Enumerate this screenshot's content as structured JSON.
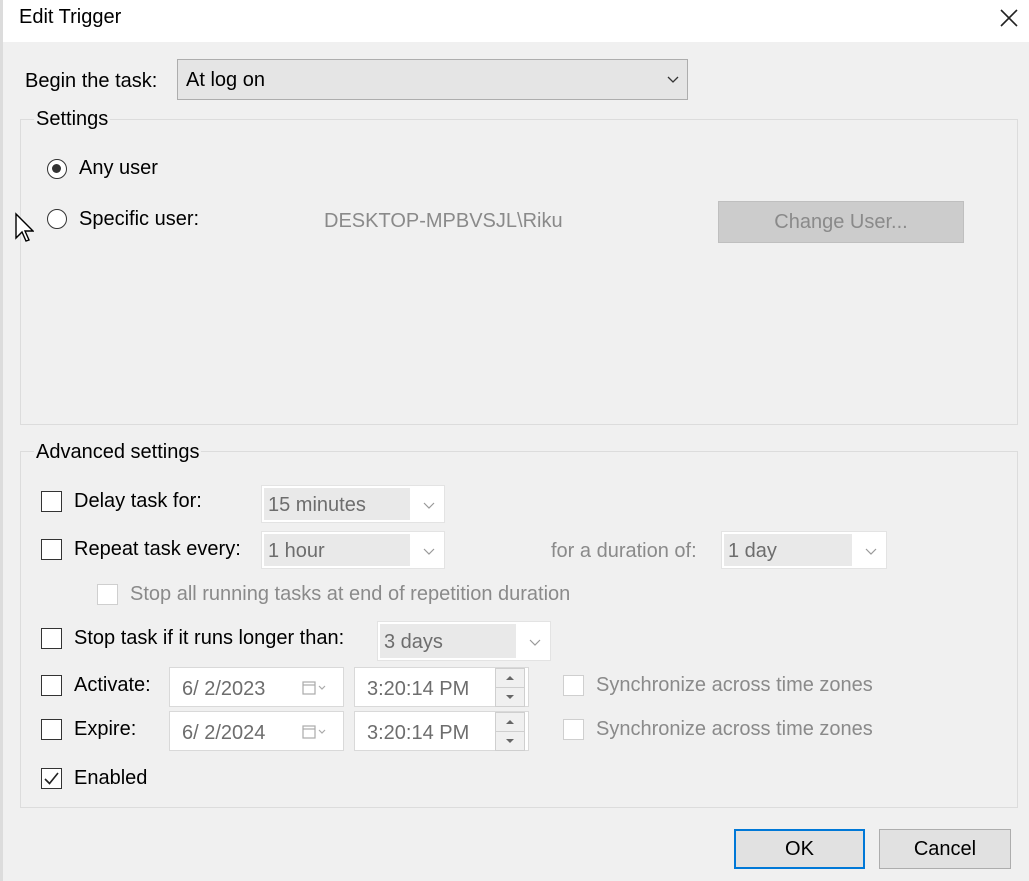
{
  "window": {
    "title": "Edit Trigger"
  },
  "begin": {
    "label": "Begin the task:",
    "value": "At log on"
  },
  "settings": {
    "title": "Settings",
    "any_user_label": "Any user",
    "specific_user_label": "Specific user:",
    "user_name": "DESKTOP-MPBVSJL\\Riku",
    "change_user_button": "Change User...",
    "selected": "any_user"
  },
  "advanced": {
    "title": "Advanced settings",
    "delay": {
      "label": "Delay task for:",
      "value": "15 minutes",
      "checked": false
    },
    "repeat": {
      "label": "Repeat task every:",
      "value": "1 hour",
      "checked": false,
      "duration_label": "for a duration of:",
      "duration_value": "1 day"
    },
    "stop_running": {
      "label": "Stop all running tasks at end of repetition duration",
      "checked": false
    },
    "stop_longer": {
      "label": "Stop task if it runs longer than:",
      "value": "3 days",
      "checked": false
    },
    "activate": {
      "label": "Activate:",
      "date": "6/ 2/2023",
      "time": "3:20:14 PM",
      "sync_label": "Synchronize across time zones",
      "checked": false
    },
    "expire": {
      "label": "Expire:",
      "date": "6/ 2/2024",
      "time": "3:20:14 PM",
      "sync_label": "Synchronize across time zones",
      "checked": false
    },
    "enabled": {
      "label": "Enabled",
      "checked": true
    }
  },
  "buttons": {
    "ok": "OK",
    "cancel": "Cancel"
  },
  "colors": {
    "accent": "#0078d7",
    "dialog_bg": "#f0f0f0",
    "disabled_text": "#8a8a8a"
  }
}
